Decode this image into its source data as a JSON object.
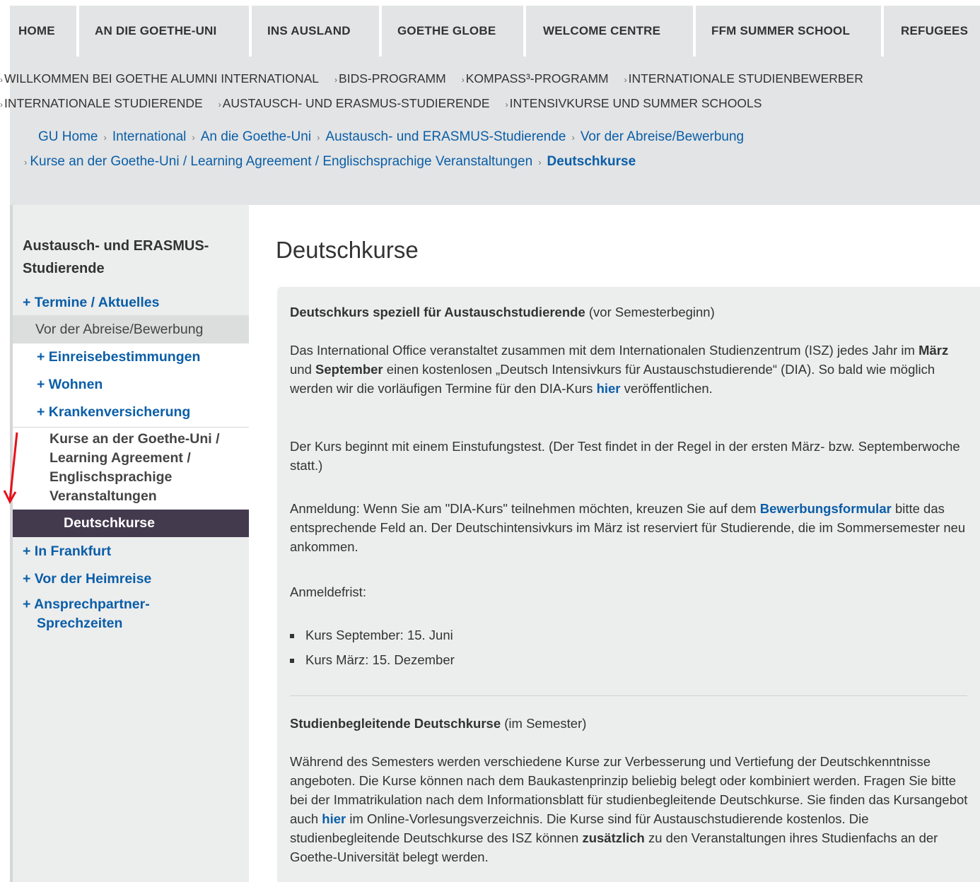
{
  "nav": {
    "items": [
      "HOME",
      "AN DIE GOETHE-UNI",
      "INS AUSLAND",
      "GOETHE GLOBE",
      "WELCOME CENTRE",
      "FFM SUMMER SCHOOL",
      "REFUGEES"
    ]
  },
  "subnav": {
    "row1": [
      "WILLKOMMEN BEI GOETHE ALUMNI INTERNATIONAL",
      "BIDS-PROGRAMM",
      "KOMPASS³-PROGRAMM",
      "INTERNATIONALE STUDIENBEWERBER"
    ],
    "row2": [
      "INTERNATIONALE STUDIERENDE",
      "AUSTAUSCH- UND ERASMUS-STUDIERENDE",
      "INTENSIVKURSE UND SUMMER SCHOOLS"
    ]
  },
  "breadcrumb": {
    "row1": [
      "GU Home",
      "International",
      "An die Goethe-Uni",
      "Austausch- und ERASMUS-Studierende",
      "Vor der Abreise/Bewerbung"
    ],
    "row2": [
      "Kurse an der Goethe-Uni / Learning Agreement / Englischsprachige Veranstaltungen"
    ],
    "current": "Deutschkurse"
  },
  "sidebar": {
    "title": "Austausch- und ERASMUS-Studierende",
    "termine": "+ Termine / Aktuelles",
    "vor_abreise": "Vor der Abreise/Bewerbung",
    "einreise": "+ Einreisebestimmungen",
    "wohnen": "+ Wohnen",
    "kranken": "+ Krankenversicherung",
    "kurse": "Kurse an der Goethe-Uni / Learning Agreement / Englischsprachige Veranstaltungen",
    "deutschkurse": "Deutschkurse",
    "frankfurt": "+ In Frankfurt",
    "heimreise": "+ Vor der Heimreise",
    "ansprech": "+ Ansprechpartner-",
    "ansprech2": "Sprechzeiten"
  },
  "content": {
    "title": "Deutschkurse",
    "h1_bold": "Deutschkurs speziell für Austauschstudierende",
    "h1_rest": " (vor Semesterbeginn)",
    "p1_a": "Das International Office veranstaltet zusammen mit dem Internationalen Studienzentrum (ISZ) jedes Jahr im ",
    "p1_marz": "März",
    "p1_und": " und ",
    "p1_sept": "September",
    "p1_b": " einen kostenlosen „Deutsch Intensivkurs für Austauschstudierende“ (DIA). So bald wie möglich werden wir die vorläufigen Termine für den DIA-Kurs ",
    "p1_link": "hier",
    "p1_c": " veröffentlichen.",
    "p2": "Der Kurs beginnt mit einem Einstufungstest. (Der Test findet in der Regel in der ersten März- bzw. Septemberwoche statt.)",
    "p3_a": "Anmeldung: Wenn Sie am \"DIA-Kurs\" teilnehmen möchten, kreuzen Sie auf dem ",
    "p3_link": "Bewerbungsformular",
    "p3_b": " bitte das entsprechende Feld an. Der Deutschintensivkurs im März ist reserviert für Studierende, die im Sommersemester neu ankommen.",
    "frist": "Anmeldefrist:",
    "bullet1": "Kurs September: 15. Juni",
    "bullet2": "Kurs März: 15. Dezember",
    "h2_bold": "Studienbegleitende Deutschkurse",
    "h2_rest": " (im Semester)",
    "p4_a": "Während des Semesters werden verschiedene Kurse zur Verbesserung und Vertiefung der Deutschkenntnisse angeboten. Die Kurse können nach dem Baukastenprinzip beliebig belegt oder kombiniert werden. Fragen Sie bitte bei der Immatrikulation nach dem Informationsblatt für studienbegleitende Deutschkurse. Sie finden das Kursangebot auch ",
    "p4_link": "hier",
    "p4_b": " im Online-Vorlesungsverzeichnis. Die Kurse sind für Austauschstudierende kostenlos. Die studienbegleitende Deutschkurse des ISZ können ",
    "p4_bold": "zusätzlich",
    "p4_c": " zu den Veranstaltungen ihres Studienfachs an der Goethe-Universität belegt werden."
  },
  "colors": {
    "link": "#0a5ea8",
    "active_nav": "#433a4e",
    "panel": "#eceded",
    "arrow": "#e8101a"
  }
}
